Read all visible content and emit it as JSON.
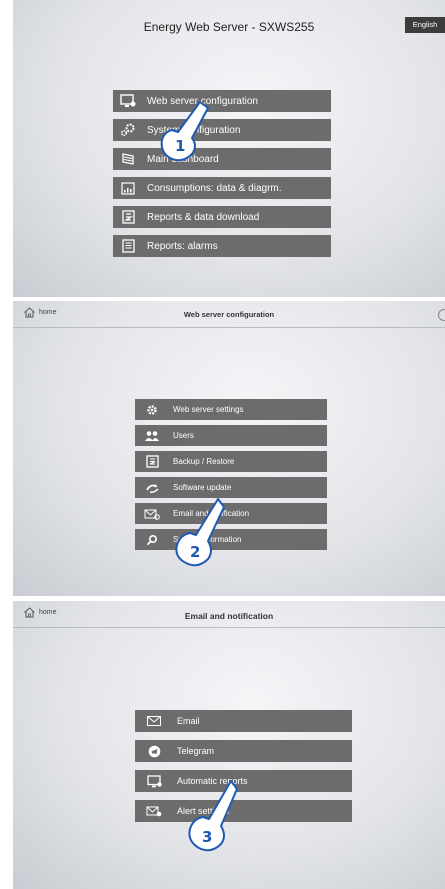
{
  "screen1": {
    "title": "Energy Web Server - SXWS255",
    "language": "English",
    "menu": [
      {
        "label": "Web server configuration"
      },
      {
        "label": "System configuration"
      },
      {
        "label": "Main dashboard"
      },
      {
        "label": "Consumptions: data & diagrm."
      },
      {
        "label": "Reports & data download"
      },
      {
        "label": "Reports: alarms"
      }
    ],
    "step": "1"
  },
  "screen2": {
    "home_label": "home",
    "title": "Web server configuration",
    "menu": [
      {
        "label": "Web server settings"
      },
      {
        "label": "Users"
      },
      {
        "label": "Backup / Restore"
      },
      {
        "label": "Software update"
      },
      {
        "label": "Email and notification"
      },
      {
        "label": "System information"
      }
    ],
    "step": "2"
  },
  "screen3": {
    "home_label": "home",
    "title": "Email and notification",
    "menu": [
      {
        "label": "Email"
      },
      {
        "label": "Telegram"
      },
      {
        "label": "Automatic reports"
      },
      {
        "label": "Alert settings"
      }
    ],
    "step": "3"
  },
  "colors": {
    "menu_item": "#6c6c6c",
    "menu_text": "#ffffff",
    "lang_button": "#3c3c3c",
    "step_number": "#1e5ab4"
  }
}
